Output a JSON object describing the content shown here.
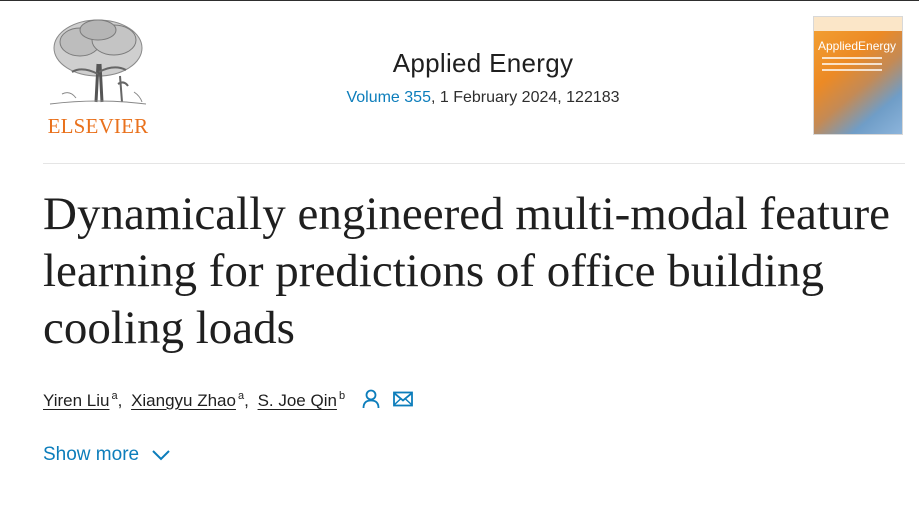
{
  "header": {
    "publisher_logo_text": "ELSEVIER",
    "journal_title": "Applied Energy",
    "volume_link": "Volume 355",
    "issue_details": ", 1 February 2024, 122183",
    "cover_title": "AppliedEnergy"
  },
  "article": {
    "title": "Dynamically engineered multi-modal feature learning for predictions of office building cooling loads"
  },
  "authors": [
    {
      "name": "Yiren Liu",
      "aff": "a",
      "sep": ","
    },
    {
      "name": "Xiangyu Zhao",
      "aff": "a",
      "sep": ","
    },
    {
      "name": "S. Joe Qin",
      "aff": "b",
      "sep": ""
    }
  ],
  "icons": {
    "author_icon": "person-icon",
    "email_icon": "envelope-icon",
    "expand_icon": "chevron-down-icon"
  },
  "show_more_label": "Show more",
  "colors": {
    "link": "#0c7dbb",
    "elsevier_orange": "#e9711c",
    "text": "#1f1f1f"
  }
}
